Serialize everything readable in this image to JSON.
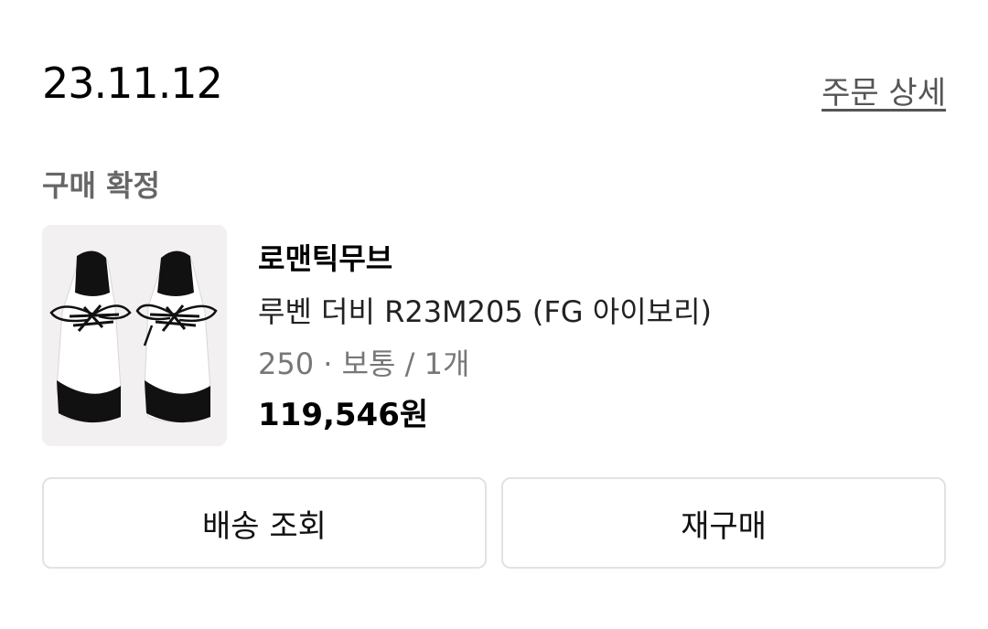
{
  "order": {
    "date": "23.11.12",
    "detail_link": "주문 상세",
    "status": "구매 확정"
  },
  "product": {
    "image_icon": "shoes-image",
    "brand": "로맨틱무브",
    "name": "루벤 더비 R23M205 (FG 아이보리)",
    "option": "250 · 보통 / 1개",
    "price": "119,546원"
  },
  "actions": {
    "track_label": "배송 조회",
    "rebuy_label": "재구매"
  }
}
